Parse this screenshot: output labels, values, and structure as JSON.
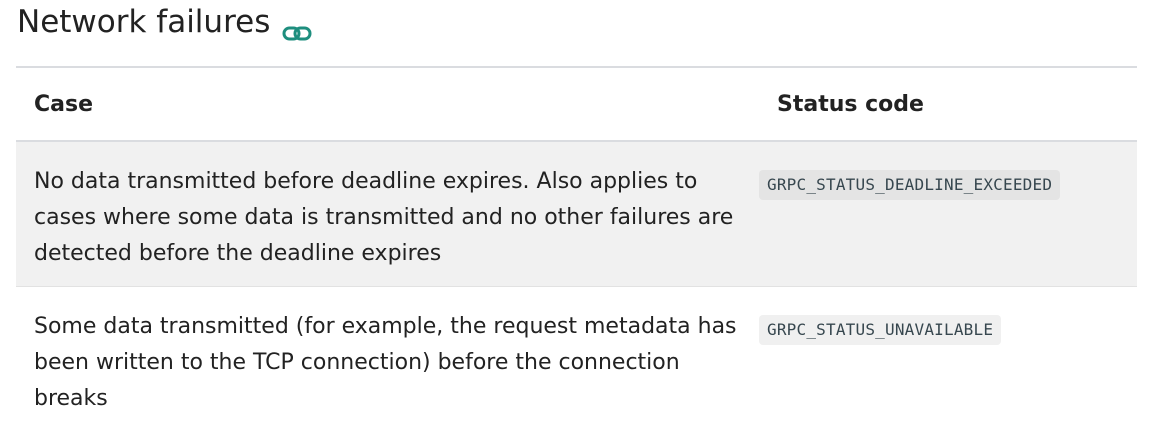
{
  "heading": {
    "title": "Network failures",
    "icon": "link-icon",
    "accent": "#1e8e7e"
  },
  "table": {
    "headers": [
      "Case",
      "Status code"
    ],
    "rows": [
      {
        "case": "No data transmitted before deadline expires. Also applies to cases where some data is transmitted and no other failures are detected before the deadline expires",
        "status": "GRPC_STATUS_DEADLINE_EXCEEDED"
      },
      {
        "case": "Some data transmitted (for example, the request metadata has been written to the TCP connection) before the connection breaks",
        "status": "GRPC_STATUS_UNAVAILABLE"
      }
    ]
  }
}
